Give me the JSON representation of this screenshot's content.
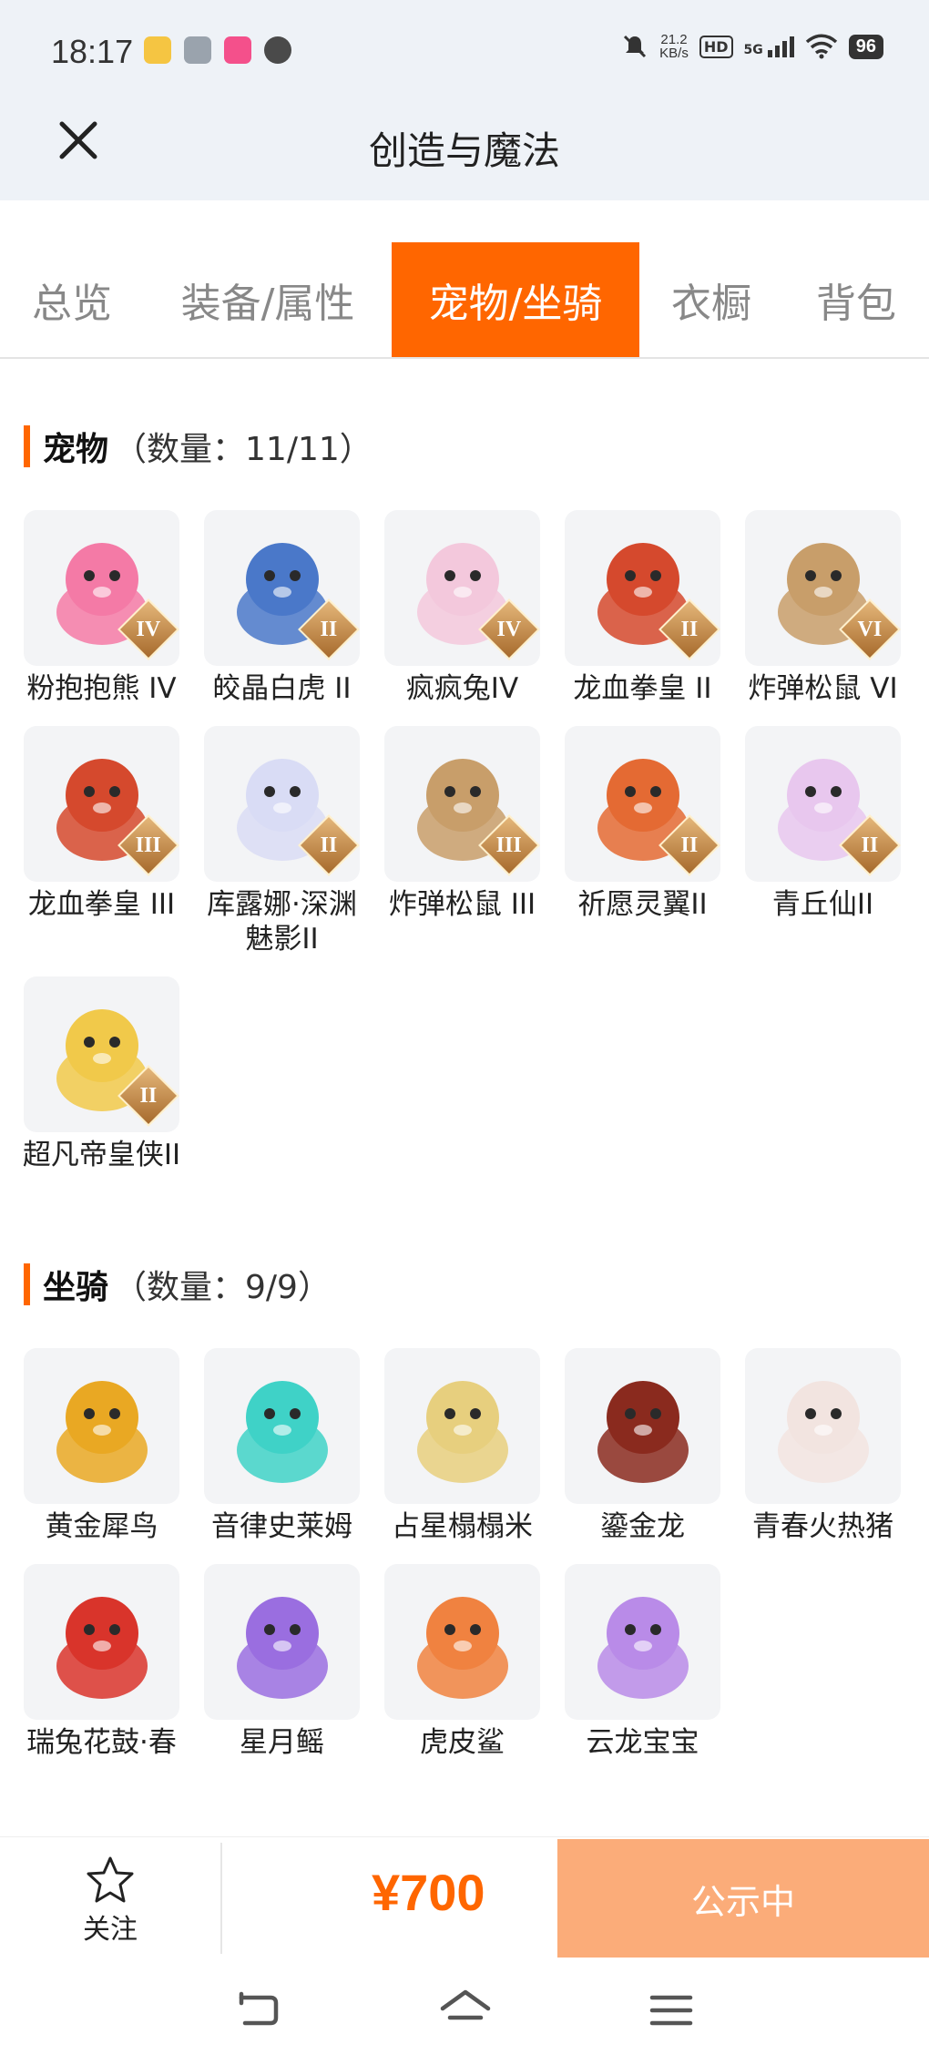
{
  "status": {
    "time": "18:17",
    "speed_value": "21.2",
    "speed_unit": "KB/s",
    "hd": "HD",
    "network": "5G",
    "battery": "96"
  },
  "header": {
    "title": "创造与魔法"
  },
  "tabs": [
    {
      "label": "总览"
    },
    {
      "label": "装备/属性"
    },
    {
      "label": "宠物/坐骑"
    },
    {
      "label": "衣橱"
    },
    {
      "label": "背包"
    }
  ],
  "pets": {
    "title": "宠物",
    "count": "（数量：11/11）",
    "items": [
      {
        "name": "粉抱抱熊 IV",
        "rank": "IV",
        "icon": "pink-bear-icon",
        "color": "#f47aa6"
      },
      {
        "name": "皎晶白虎 II",
        "rank": "II",
        "icon": "white-tiger-icon",
        "color": "#4a78c9"
      },
      {
        "name": "疯疯兔IV",
        "rank": "IV",
        "icon": "rabbit-icon",
        "color": "#f3c8dc"
      },
      {
        "name": "龙血拳皇 II",
        "rank": "II",
        "icon": "dragon-boxer-icon",
        "color": "#d5492d"
      },
      {
        "name": "炸弹松鼠 VI",
        "rank": "VI",
        "icon": "squirrel-icon",
        "color": "#c89e6a"
      },
      {
        "name": "龙血拳皇 III",
        "rank": "III",
        "icon": "dragon-boxer-icon",
        "color": "#d5492d"
      },
      {
        "name": "库露娜·深渊魅影II",
        "rank": "II",
        "icon": "abyss-ghost-icon",
        "color": "#d9dcf5"
      },
      {
        "name": "炸弹松鼠 III",
        "rank": "III",
        "icon": "squirrel-icon",
        "color": "#c89e6a"
      },
      {
        "name": "祈愿灵翼II",
        "rank": "II",
        "icon": "spirit-wing-icon",
        "color": "#e46a33"
      },
      {
        "name": "青丘仙II",
        "rank": "II",
        "icon": "fox-fairy-icon",
        "color": "#e8c7ee"
      },
      {
        "name": "超凡帝皇侠II",
        "rank": "II",
        "icon": "emperor-knight-icon",
        "color": "#f1c94a"
      }
    ]
  },
  "mounts": {
    "title": "坐骑",
    "count": "（数量：9/9）",
    "items": [
      {
        "name": "黄金犀鸟",
        "icon": "hornbill-icon",
        "color": "#e9a823"
      },
      {
        "name": "音律史莱姆",
        "icon": "slime-icon",
        "color": "#3fd2c7"
      },
      {
        "name": "占星榻榻米",
        "icon": "astro-tatami-icon",
        "color": "#e7cf7e"
      },
      {
        "name": "鎏金龙",
        "icon": "gilded-dragon-icon",
        "color": "#8a2a1e"
      },
      {
        "name": "青春火热猪",
        "icon": "pig-icon",
        "color": "#f2e4e0"
      },
      {
        "name": "瑞兔花鼓·春",
        "icon": "drum-icon",
        "color": "#d9342b"
      },
      {
        "name": "星月鳐",
        "icon": "ray-icon",
        "color": "#9a6ee0"
      },
      {
        "name": "虎皮鲨",
        "icon": "shark-icon",
        "color": "#f08240"
      },
      {
        "name": "云龙宝宝",
        "icon": "cloud-dragon-icon",
        "color": "#b98be8"
      }
    ]
  },
  "footer": {
    "follow_label": "关注",
    "price": "¥700",
    "status_button": "公示中"
  },
  "colors": {
    "accent": "#ff6600",
    "cta": "#fbac79"
  }
}
